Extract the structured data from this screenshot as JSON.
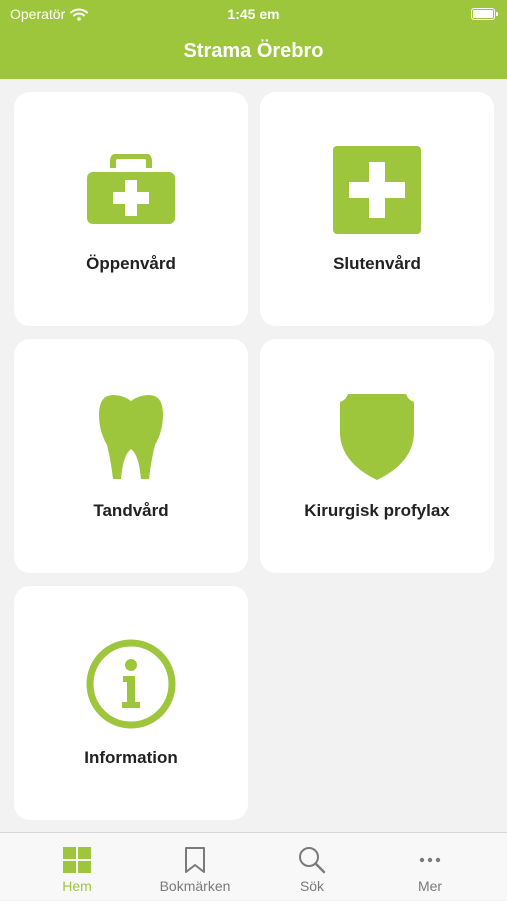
{
  "status_bar": {
    "carrier": "Operatör",
    "time": "1:45 em"
  },
  "header": {
    "title": "Strama Örebro"
  },
  "cards": [
    {
      "label": "Öppenvård",
      "icon": "medical-bag-icon"
    },
    {
      "label": "Slutenvård",
      "icon": "medical-cross-icon"
    },
    {
      "label": "Tandvård",
      "icon": "tooth-icon"
    },
    {
      "label": "Kirurgisk profylax",
      "icon": "shield-icon"
    },
    {
      "label": "Information",
      "icon": "info-icon"
    }
  ],
  "tabbar": {
    "tabs": [
      {
        "label": "Hem",
        "icon": "grid-icon",
        "active": true
      },
      {
        "label": "Bokmärken",
        "icon": "bookmark-icon",
        "active": false
      },
      {
        "label": "Sök",
        "icon": "search-icon",
        "active": false
      },
      {
        "label": "Mer",
        "icon": "more-icon",
        "active": false
      }
    ]
  },
  "colors": {
    "accent": "#9dc63c",
    "background": "#f2f2f2",
    "card": "#ffffff",
    "inactive": "#7a7a7a"
  }
}
